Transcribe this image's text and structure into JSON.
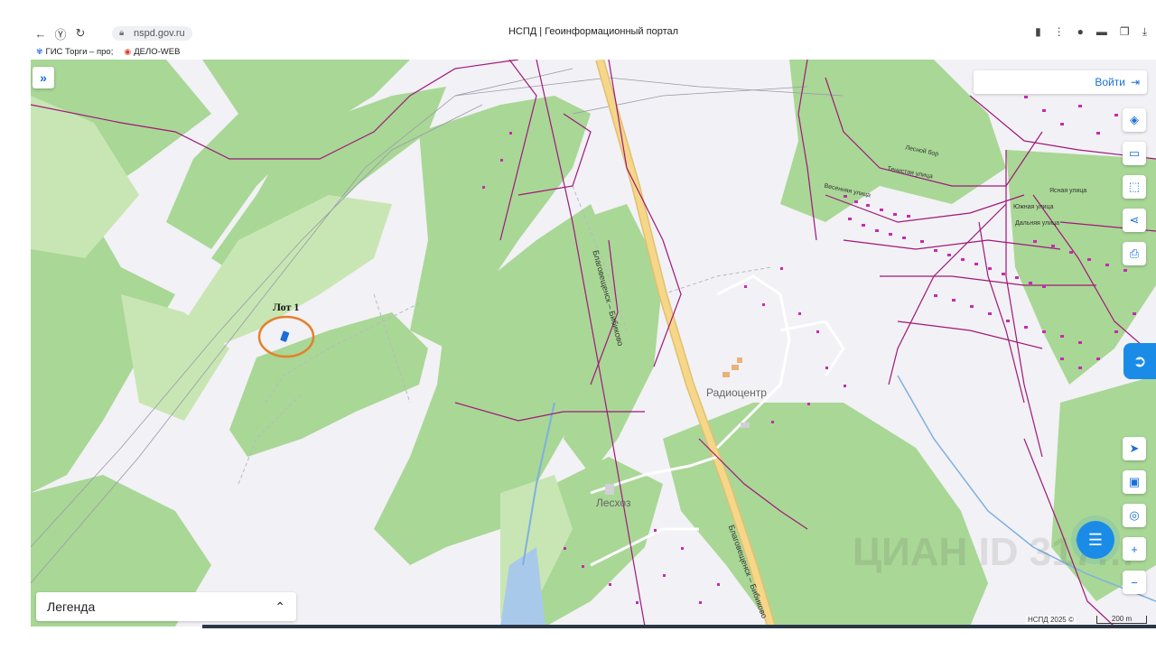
{
  "browser": {
    "url": "nspd.gov.ru",
    "page_title": "НСПД | Геоинформационный портал",
    "bookmarks": [
      {
        "label": "ГИС Торги – про;",
        "icon": "gis-torgi-icon"
      },
      {
        "label": "ДЕЛО-WEB",
        "icon": "delo-web-icon"
      }
    ]
  },
  "map": {
    "login_label": "Войти",
    "legend_label": "Легенда",
    "attribution": "НСПД 2025 ©",
    "scale_label": "200 m",
    "watermark": "ЦИАН ID 317…",
    "labels": {
      "lot": "Лот 1",
      "village1": "Радиоцентр",
      "village2": "Лесхоз",
      "road": "Благовещенск – Бибиково",
      "street1": "Весенняя улица",
      "street2": "Тенистая улица",
      "street3": "Южная улица",
      "street4": "Дальняя улица",
      "street5": "Ясная улица",
      "street6": "Лесной бор"
    },
    "colors": {
      "forest": "#a9d796",
      "meadow": "#c8e6b3",
      "road": "#f6d78a",
      "cadastre": "#a0187a",
      "marker": "#e5802d",
      "accent": "#1a6fd6"
    }
  },
  "controls": {
    "expand_icon": "double-chevron-right-icon",
    "right_tools": [
      "layers-icon",
      "ruler-icon",
      "select-area-icon",
      "share-icon",
      "print-icon"
    ],
    "nav_tools": [
      "locate-arrow-icon",
      "minimap-icon",
      "geo-search-icon"
    ],
    "zoom_in": "+",
    "zoom_out": "−"
  }
}
